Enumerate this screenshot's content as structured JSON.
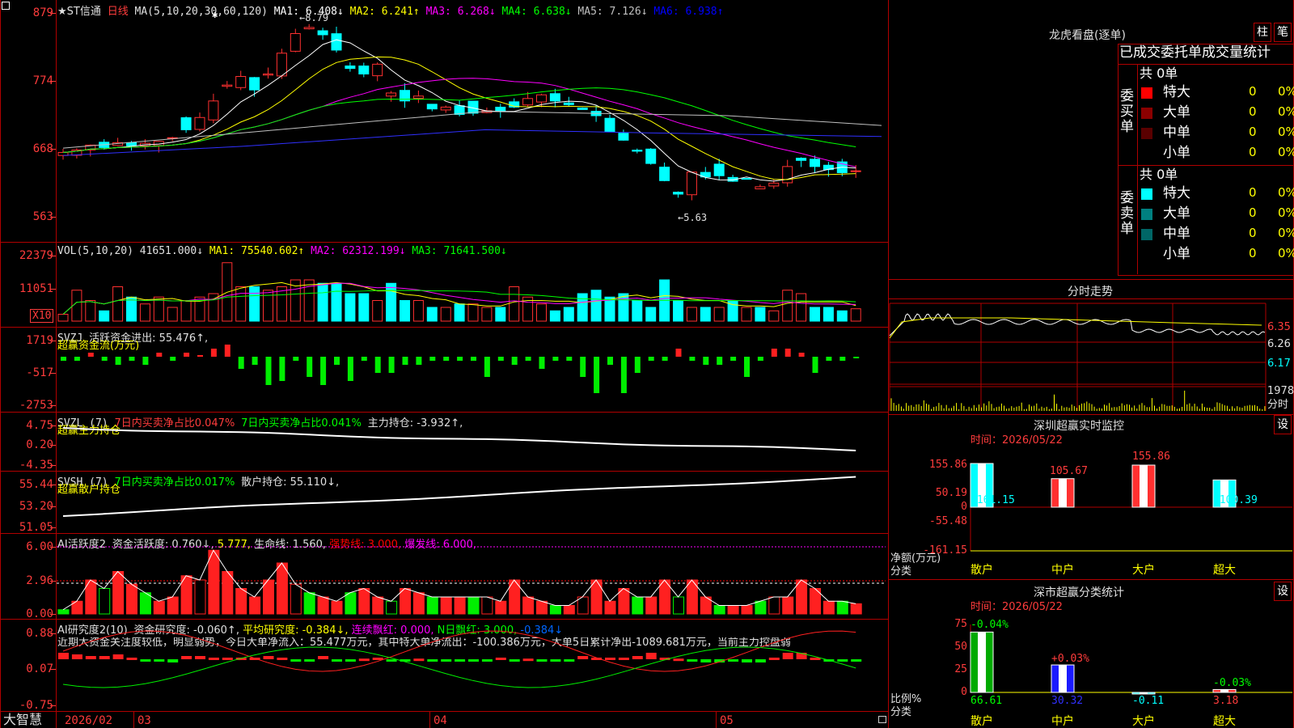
{
  "title_bar": {
    "stock": "★ST信通",
    "period": "日线",
    "ma_label": "MA(5,10,20,30,60,120)",
    "ma_items": [
      {
        "label": "MA1: 6.408↓",
        "color": "#ffffff"
      },
      {
        "label": "MA2: 6.241↑",
        "color": "#ffff00"
      },
      {
        "label": "MA3: 6.268↓",
        "color": "#ff00ff"
      },
      {
        "label": "MA4: 6.638↓",
        "color": "#00ff00"
      },
      {
        "label": "MA5: 7.126↓",
        "color": "#c0c0c0"
      },
      {
        "label": "MA6: 6.938↑",
        "color": "#0000ff"
      }
    ],
    "high_mark": "←8.79",
    "low_mark": "←5.63",
    "y_ticks": [
      "879",
      "774",
      "668",
      "563"
    ]
  },
  "vol_panel": {
    "header": "VOL(5,10,20)",
    "value": "41651.000↓",
    "ma": [
      {
        "label": "MA1: 75540.602↑",
        "color": "#ffff00"
      },
      {
        "label": "MA2: 62312.199↓",
        "color": "#ff00ff"
      },
      {
        "label": "MA3: 71641.500↓",
        "color": "#00ff00"
      }
    ],
    "y_ticks": [
      "22379",
      "11051"
    ],
    "unit": "X10"
  },
  "svzj_panel": {
    "header": "SVZJ",
    "label": "活跃资金进出: 55.476↑,",
    "subtitle": "超赢资金流(万元)",
    "y_ticks": [
      "1719",
      "-517",
      "-2753"
    ]
  },
  "svzl_panel": {
    "header": "SVZL (7)",
    "label1": "7日内买卖净占比0.047%",
    "label2": "7日内买卖净占比0.041%",
    "label3": "主力持仓: -3.932↑,",
    "subtitle": "超赢主力持仓",
    "y_ticks": [
      "4.75",
      "0.20",
      "-4.35"
    ]
  },
  "svsh_panel": {
    "header": "SVSH (7)",
    "label1": "7日内买卖净占比0.017%",
    "label2": "散户持仓: 55.110↓,",
    "subtitle": "超赢散户持仓",
    "y_ticks": [
      "55.44",
      "53.20",
      "51.05"
    ]
  },
  "ai1_panel": {
    "header": "AI活跃度2",
    "items": [
      {
        "label": "资金活跃度: 0.760↓,",
        "color": "#e0e0e0"
      },
      {
        "label": "5.777,",
        "color": "#ffff00"
      },
      {
        "label": "生命线: 1.560,",
        "color": "#e0e0e0"
      },
      {
        "label": "强势线: 3.000,",
        "color": "#ff0000"
      },
      {
        "label": "爆发线: 6.000,",
        "color": "#ff00ff"
      }
    ],
    "y_ticks": [
      "6.00",
      "2.96",
      "0.00"
    ]
  },
  "ai2_panel": {
    "header": "AI研究度2(10)",
    "items": [
      {
        "label": "资金研究度: -0.060↑,",
        "color": "#e0e0e0"
      },
      {
        "label": "平均研究度: -0.384↓,",
        "color": "#ffff00"
      },
      {
        "label": "连续飘红: 0.000,",
        "color": "#ff00ff"
      },
      {
        "label": "N日飘红: 3.000,",
        "color": "#00ff00"
      },
      {
        "label": "-0.384↓",
        "color": "#0066ff"
      }
    ],
    "comment": "近期大资金关注度较低，明显弱势，今日大单净流入：55.477万元，其中特大单净流出：-100.386万元，大单5日累计净出-1089.681万元，当前主力控盘弱",
    "y_ticks": [
      "0.88",
      "0.07",
      "-0.75"
    ]
  },
  "x_axis": {
    "brand": "大智慧",
    "labels": [
      "2026/02",
      "03",
      "04",
      "05"
    ]
  },
  "right_panel": {
    "lhb": {
      "title": "龙虎看盘(逐单)",
      "btn1": "柱",
      "btn2": "笔",
      "subtitle": "已成交委托单成交量统计",
      "buy_label": "委买单",
      "sell_label": "委卖单",
      "buy_total": "共 0单",
      "sell_total": "共 0单",
      "buy_rows": [
        {
          "label": "特大",
          "count": "0",
          "pct": "0%",
          "color": "#ff0000"
        },
        {
          "label": "大单",
          "count": "0",
          "pct": "0%",
          "color": "#8b0000"
        },
        {
          "label": "中单",
          "count": "0",
          "pct": "0%",
          "color": "#5a0000"
        },
        {
          "label": "小单",
          "count": "0",
          "pct": "0%",
          "color": ""
        }
      ],
      "sell_rows": [
        {
          "label": "特大",
          "count": "0",
          "pct": "0%",
          "color": "#00ffff"
        },
        {
          "label": "大单",
          "count": "0",
          "pct": "0%",
          "color": "#008080"
        },
        {
          "label": "中单",
          "count": "0",
          "pct": "0%",
          "color": "#006666"
        },
        {
          "label": "小单",
          "count": "0",
          "pct": "0%",
          "color": ""
        }
      ]
    },
    "intraday": {
      "title": "分时走势",
      "y_ticks": [
        "6.35",
        "6.26",
        "6.17"
      ],
      "vol_tick": "1978",
      "vol_unit": "分时"
    },
    "sz_monitor": {
      "title": "深圳超赢实时监控",
      "btn": "设",
      "time": "时间：2026/05/22",
      "y_ticks": [
        "155.86",
        "50.19",
        "0",
        "-55.48",
        "-161.15"
      ],
      "axis_label1": "净额(万元)",
      "axis_label2": "分类",
      "categories": [
        "散户",
        "中户",
        "大户",
        "超大"
      ],
      "values": [
        -161.15,
        105.67,
        155.86,
        -100.39
      ],
      "value_labels": [
        "-161.15",
        "105.67",
        "155.86",
        "-100.39"
      ]
    },
    "sz_class": {
      "title": "深市超赢分类统计",
      "btn": "设",
      "time": "时间：2026/05/22",
      "y_ticks": [
        "75",
        "50",
        "25",
        "0"
      ],
      "axis_label1": "比例%",
      "axis_label2": "分类",
      "categories": [
        "散户",
        "中户",
        "大户",
        "超大"
      ],
      "values": [
        66.61,
        30.32,
        -0.11,
        3.18
      ],
      "bottom_labels": [
        "66.61",
        "30.32",
        "-0.11",
        "3.18"
      ],
      "top_labels": [
        "-0.04%",
        "+0.03%",
        "",
        "-0.03%"
      ]
    }
  }
}
